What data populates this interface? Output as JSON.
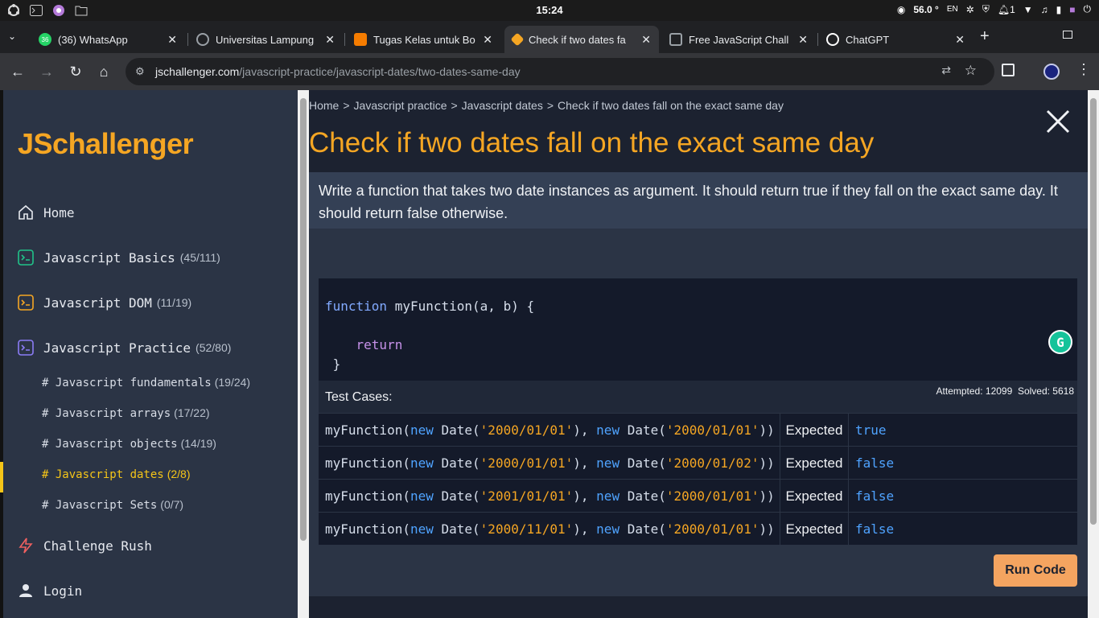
{
  "os": {
    "clock": "15:24",
    "temp": "56.0 °",
    "lang": "EN",
    "notif_count": "1"
  },
  "tabs": [
    {
      "label": "(36) WhatsApp",
      "badge": "36",
      "color": "#25d366"
    },
    {
      "label": "Universitas Lampung",
      "color": "#9aa0a6"
    },
    {
      "label": "Tugas Kelas untuk Bo",
      "color": "#f57c00"
    },
    {
      "label": "Check if two dates fa",
      "color": "#f5a623"
    },
    {
      "label": "Free JavaScript Chall",
      "color": "#9aa0a6"
    },
    {
      "label": "ChatGPT",
      "color": "#ffffff"
    }
  ],
  "address": {
    "host": "jschallenger.com",
    "path": "/javascript-practice/javascript-dates/two-dates-same-day"
  },
  "sidebar": {
    "logo_js": "JS",
    "logo_rest": "challenger",
    "home": "Home",
    "items": [
      {
        "label": "Javascript Basics",
        "count": "(45/111)",
        "color": "#21c389"
      },
      {
        "label": "Javascript DOM",
        "count": "(11/19)",
        "color": "#f5a623"
      },
      {
        "label": "Javascript Practice",
        "count": "(52/80)",
        "color": "#8b7cf6"
      }
    ],
    "sub_items": [
      {
        "label": "# Javascript fundamentals",
        "count": "(19/24)"
      },
      {
        "label": "# Javascript arrays",
        "count": "(17/22)"
      },
      {
        "label": "# Javascript objects",
        "count": "(14/19)"
      },
      {
        "label": "# Javascript dates",
        "count": "(2/8)"
      },
      {
        "label": "# Javascript Sets",
        "count": "(0/7)"
      }
    ],
    "challenge_rush": "Challenge Rush",
    "login": "Login"
  },
  "main": {
    "breadcrumb": [
      "Home",
      "Javascript practice",
      "Javascript dates",
      "Check if two dates fall on the exact same day"
    ],
    "title": "Check if two dates fall on the exact same day",
    "description": "Write a function that takes two date instances as argument. It should return true if they fall on the exact same day. It should return false otherwise.",
    "code": {
      "kw_function": "function",
      "fn_sig": "myFunction(a, b) {",
      "kw_return": "return",
      "close": "}"
    },
    "tests_label": "Test Cases:",
    "attempted": "Attempted: 12099",
    "solved": "Solved: 5618",
    "expected_label": "Expected",
    "tests": [
      {
        "a": "'2000/01/01'",
        "b": "'2000/01/01'",
        "expected": "true"
      },
      {
        "a": "'2000/01/01'",
        "b": "'2000/01/02'",
        "expected": "false"
      },
      {
        "a": "'2001/01/01'",
        "b": "'2000/01/01'",
        "expected": "false"
      },
      {
        "a": "'2000/11/01'",
        "b": "'2000/01/01'",
        "expected": "false"
      }
    ],
    "call_parts": {
      "fn": "myFunction(",
      "new": "new",
      "date": " Date(",
      "close1": "), ",
      "close2": "))"
    },
    "run_label": "Run Code"
  }
}
